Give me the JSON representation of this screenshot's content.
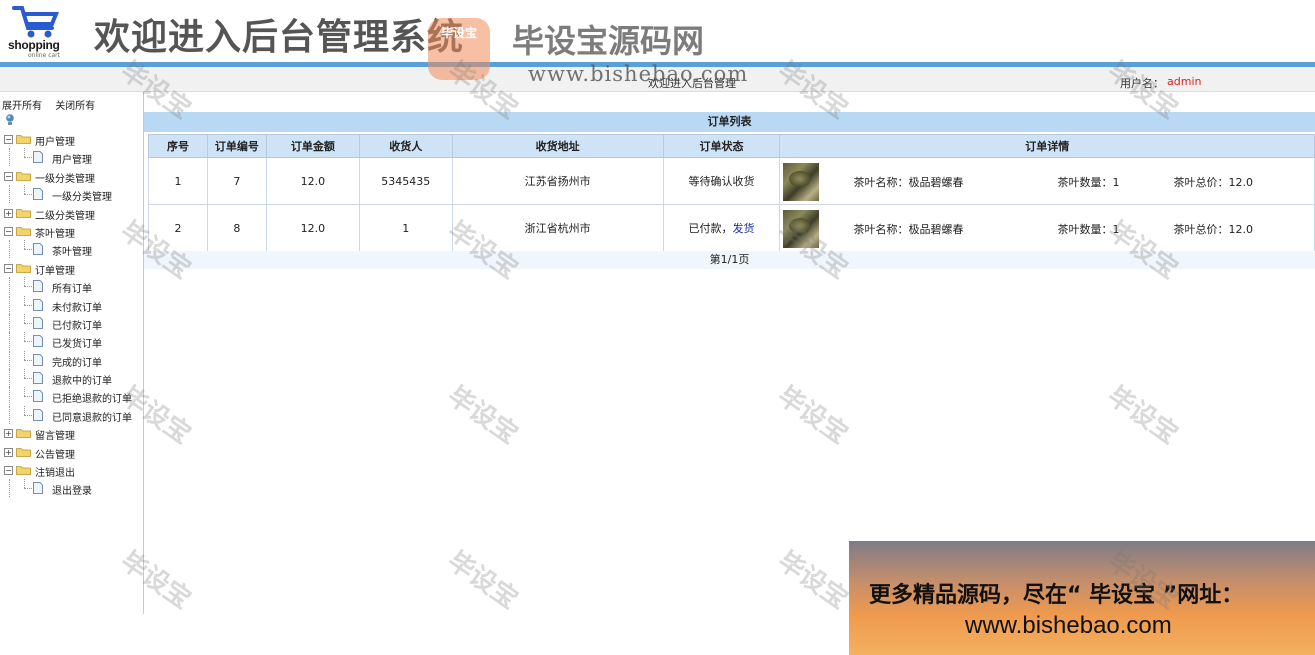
{
  "header": {
    "logo_text": "shopping",
    "logo_sub": "online cart",
    "system_title": "欢迎进入后台管理系统",
    "welcome": "欢迎进入后台管理",
    "user_label": "用户名：",
    "user_name": "admin"
  },
  "sidebar": {
    "expand_all": "展开所有",
    "collapse_all": "关闭所有",
    "tree": [
      {
        "type": "parent",
        "sign": "−",
        "label": "用户管理"
      },
      {
        "type": "child",
        "label": "用户管理"
      },
      {
        "type": "parent",
        "sign": "−",
        "label": "一级分类管理"
      },
      {
        "type": "child",
        "label": "一级分类管理"
      },
      {
        "type": "parent",
        "sign": "+",
        "label": "二级分类管理"
      },
      {
        "type": "parent",
        "sign": "−",
        "label": "茶叶管理"
      },
      {
        "type": "child",
        "label": "茶叶管理"
      },
      {
        "type": "parent",
        "sign": "−",
        "label": "订单管理"
      },
      {
        "type": "child",
        "label": "所有订单"
      },
      {
        "type": "child",
        "label": "未付款订单"
      },
      {
        "type": "child",
        "label": "已付款订单"
      },
      {
        "type": "child",
        "label": "已发货订单"
      },
      {
        "type": "child",
        "label": "完成的订单"
      },
      {
        "type": "child",
        "label": "退款中的订单"
      },
      {
        "type": "child",
        "label": "已拒绝退款的订单"
      },
      {
        "type": "child",
        "label": "已同意退款的订单"
      },
      {
        "type": "parent",
        "sign": "+",
        "label": "留言管理"
      },
      {
        "type": "parent",
        "sign": "+",
        "label": "公告管理"
      },
      {
        "type": "parent",
        "sign": "−",
        "label": "注销退出"
      },
      {
        "type": "child",
        "label": "退出登录"
      }
    ]
  },
  "main": {
    "caption": "订单列表",
    "columns": [
      "序号",
      "订单编号",
      "订单金额",
      "收货人",
      "收货地址",
      "订单状态",
      "订单详情"
    ],
    "rows": [
      {
        "index": "1",
        "order_no": "7",
        "amount": "12.0",
        "receiver": "5345435",
        "address": "江苏省扬州市",
        "status": "等待确认收货",
        "status_link": "",
        "detail_name": "茶叶名称：极品碧螺春",
        "detail_qty": "茶叶数量：1",
        "detail_total": "茶叶总价：12.0"
      },
      {
        "index": "2",
        "order_no": "8",
        "amount": "12.0",
        "receiver": "1",
        "address": "浙江省杭州市",
        "status": "已付款，",
        "status_link": "发货",
        "detail_name": "茶叶名称：极品碧螺春",
        "detail_qty": "茶叶数量：1",
        "detail_total": "茶叶总价：12.0"
      }
    ],
    "pager": "第1/1页"
  },
  "watermark": {
    "text": "毕设宝",
    "site_name": "毕设宝源码网",
    "site_url": "www.bishebao.com",
    "badge_text": "毕设宝"
  },
  "promo": {
    "line1": "更多精品源码，尽在“ 毕设宝 ”网址：",
    "line2": "www.bishebao.com"
  }
}
